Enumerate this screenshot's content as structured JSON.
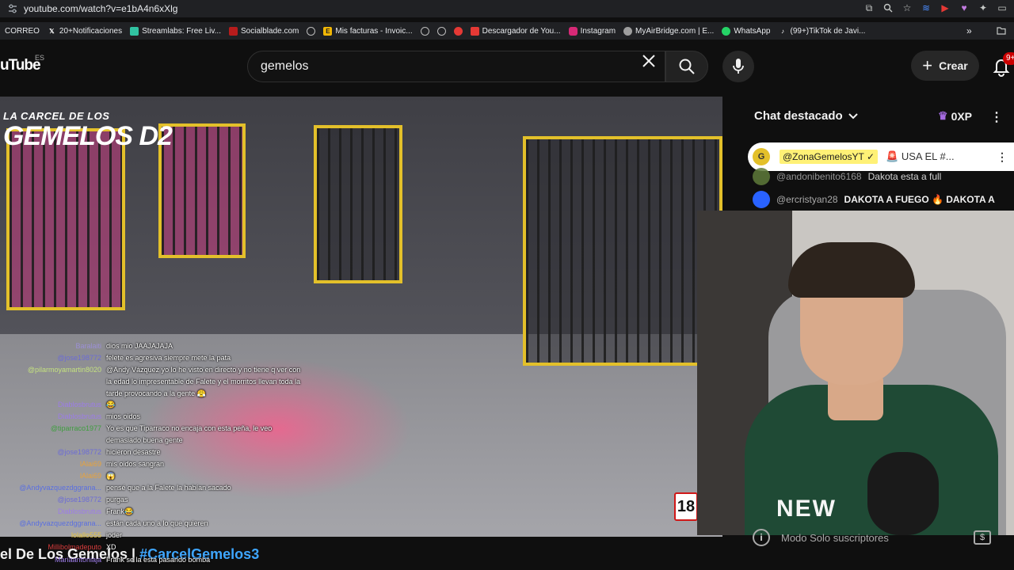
{
  "browser": {
    "url": "youtube.com/watch?v=e1bA4n6xXlg",
    "bookmarks": [
      {
        "label": "CORREO",
        "icon": "mail-icon",
        "color": "#c5221f"
      },
      {
        "label": "20+Notificaciones",
        "icon": "x-logo-icon",
        "color": "#000000"
      },
      {
        "label": "Streamlabs: Free Liv...",
        "icon": "streamlabs-icon",
        "color": "#31c3a2"
      },
      {
        "label": "Socialblade.com",
        "icon": "socialblade-icon",
        "color": "#b71c1c"
      },
      {
        "label": "Mis facturas - Invoic...",
        "icon": "invoice-icon",
        "color": "#f2b705"
      },
      {
        "label": "Descargador de You...",
        "icon": "downloader-icon",
        "color": "#e53935"
      },
      {
        "label": "Instagram",
        "icon": "instagram-icon",
        "color": "#d62976"
      },
      {
        "label": "MyAirBridge.com | E...",
        "icon": "airbridge-icon",
        "color": "#9e9e9e"
      },
      {
        "label": "WhatsApp",
        "icon": "whatsapp-icon",
        "color": "#25d366"
      },
      {
        "label": "(99+)TikTok de Javi...",
        "icon": "tiktok-icon",
        "color": "#000000"
      }
    ]
  },
  "header": {
    "logo": "uTube",
    "region": "ES",
    "search_value": "gemelos",
    "create_label": "Crear",
    "notifications_badge": "9+"
  },
  "video": {
    "overlay_line1": "LA CARCEL DE LOS",
    "overlay_line2": "GEMELOS D2",
    "rating": "18"
  },
  "chat_overlay": [
    {
      "user": "Baralaiti",
      "text": "dios mio JAAJAJAJA",
      "color": "#9b8fd6"
    },
    {
      "user": "@jose198772",
      "text": "felete es agresiva siempre mete la pata",
      "color": "#6b6bd6"
    },
    {
      "user": "@pilarmoyamartin8020",
      "text": "@Andy Vázquez yo lo he visto en directo y no tiene q ver con la edad lo impresentable de Falete y el morritos llevan toda la tarde provocando a la gente 😤",
      "color": "#c4e17f"
    },
    {
      "user": "Diablosbrutus",
      "text": "😂",
      "color": "#9c7ce8"
    },
    {
      "user": "Diablosbrutus",
      "text": "mios oidos",
      "color": "#9c7ce8"
    },
    {
      "user": "@tiparraco1977",
      "text": "Yo es que Tiparraco no encaja con esta peña, le veo demasiado buena gente",
      "color": "#3f9e3f"
    },
    {
      "user": "@jose198772",
      "text": "hicieron desastre",
      "color": "#6b6bd6"
    },
    {
      "user": "lAlai69",
      "text": "mis oidos sangran",
      "color": "#e8a33c"
    },
    {
      "user": "lAlai69",
      "text": "😱",
      "color": "#e8a33c"
    },
    {
      "user": "@Andyvazquezdggrana...",
      "text": "pensé que a la Falete la habían sacado",
      "color": "#5a6fe0"
    },
    {
      "user": "@jose198772",
      "text": "purgas",
      "color": "#6b6bd6"
    },
    {
      "user": "Diablosbrutus",
      "text": "Frank😂",
      "color": "#9c7ce8"
    },
    {
      "user": "@Andyvazquezdggrana...",
      "text": "están cada uno a lo que quieren",
      "color": "#5a6fe0"
    },
    {
      "user": "lolallo555",
      "text": "joder",
      "color": "#e8c63c"
    },
    {
      "user": "Millibolmadeputo",
      "text": "XD",
      "color": "#d63c3c"
    },
    {
      "user": "Mariaantoniaja",
      "text": "Frank se la esta pasando bomba",
      "color": "#9c7ce8"
    }
  ],
  "chat": {
    "title": "Chat destacado",
    "xp": "0XP",
    "pinned_user": "@ZonaGemelosYT ✓",
    "pinned_text": "🚨 USA EL #...",
    "messages": [
      {
        "user": "@andonibenito6168",
        "text": "Dakota esta a full",
        "avatar_color": "#5e7a3a"
      },
      {
        "user": "@ercristyan28",
        "text": "DAKOTA A FUEGO 🔥 DAKOTA A",
        "avatar_color": "#2962ff"
      }
    ],
    "footer": "Modo Solo suscriptores"
  },
  "webcam": {
    "shirt_text": "NEW"
  },
  "page": {
    "title_prefix": "el De Los Gemelos | ",
    "hashtag": "#CarcelGemelos3"
  }
}
